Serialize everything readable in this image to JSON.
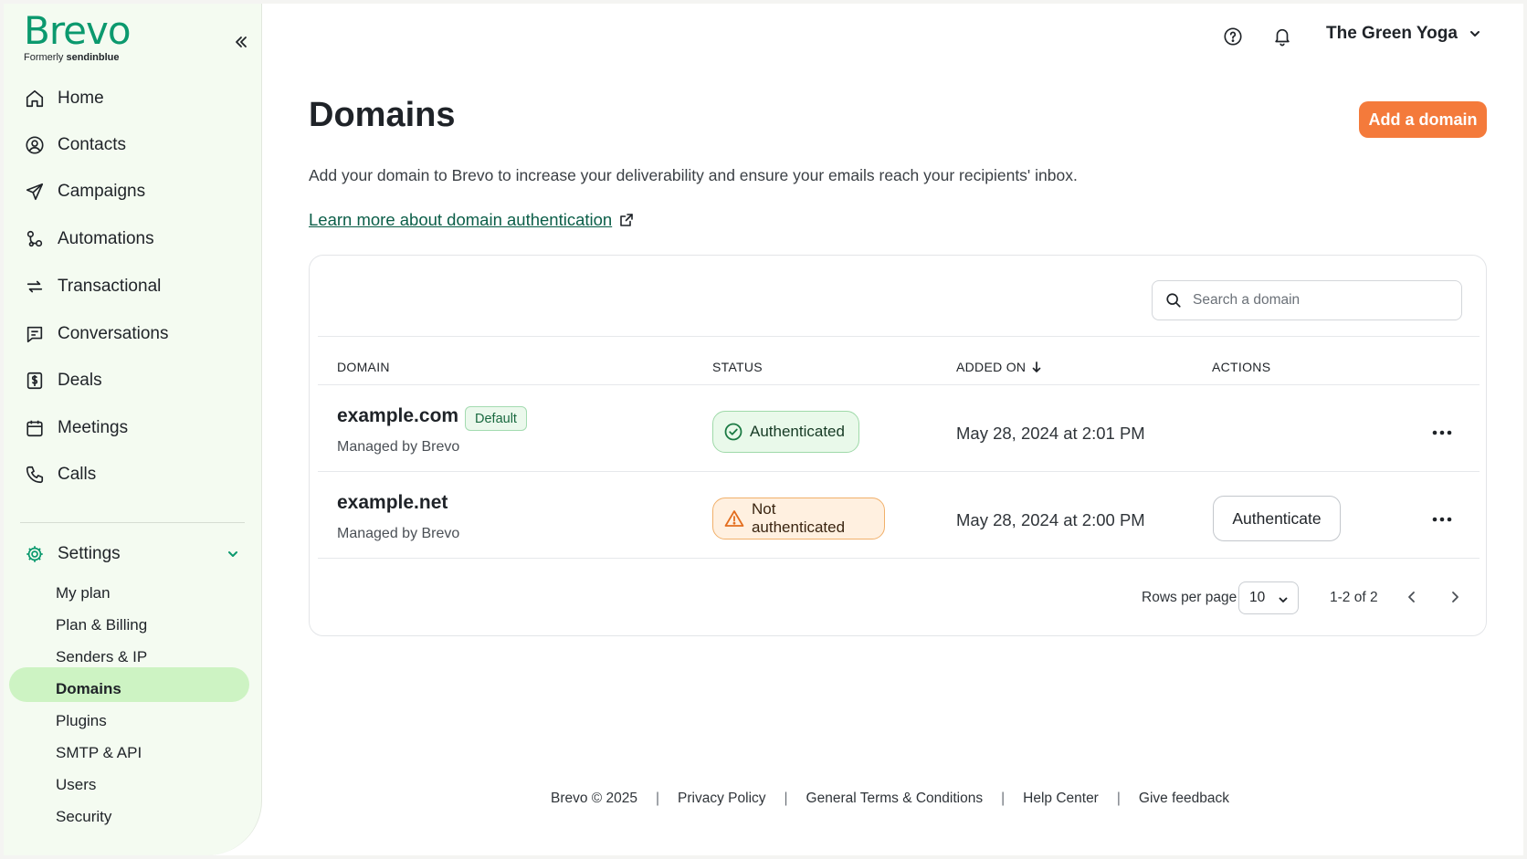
{
  "brand": {
    "logo_text": "Brevo",
    "formerly": "Formerly",
    "formerly_brand": "sendinblue",
    "accent": "#0b996e",
    "cta_color": "#f47a3b"
  },
  "header": {
    "account_name": "The Green Yoga",
    "help_icon": "help-circle-icon",
    "bell_icon": "bell-icon"
  },
  "sidebar": {
    "items": [
      {
        "label": "Home",
        "icon": "home-icon"
      },
      {
        "label": "Contacts",
        "icon": "contacts-icon"
      },
      {
        "label": "Campaigns",
        "icon": "send-icon"
      },
      {
        "label": "Automations",
        "icon": "automation-icon"
      },
      {
        "label": "Transactional",
        "icon": "repeat-icon"
      },
      {
        "label": "Conversations",
        "icon": "chat-icon"
      },
      {
        "label": "Deals",
        "icon": "dollar-icon"
      },
      {
        "label": "Meetings",
        "icon": "calendar-icon"
      },
      {
        "label": "Calls",
        "icon": "phone-icon"
      }
    ],
    "settings": {
      "label": "Settings",
      "icon": "gear-icon",
      "sub_items": [
        "My plan",
        "Plan & Billing",
        "Senders & IP",
        "Domains",
        "Plugins",
        "SMTP & API",
        "Users",
        "Security"
      ],
      "active": "Domains"
    }
  },
  "main": {
    "title": "Domains",
    "add_button": "Add a domain",
    "description": "Add your domain to Brevo to increase your deliverability and ensure your emails reach your recipients' inbox.",
    "learn_link": "Learn more about domain authentication",
    "search_placeholder": "Search a domain",
    "columns": [
      "DOMAIN",
      "STATUS",
      "ADDED ON",
      "ACTIONS"
    ],
    "rows": [
      {
        "domain": "example.com",
        "badge": "Default",
        "managed": "Managed by Brevo",
        "status": "Authenticated",
        "added_on": "May 28, 2024 at 2:01 PM"
      },
      {
        "domain": "example.net",
        "managed": "Managed by Brevo",
        "status": "Not authenticated",
        "added_on": "May 28, 2024 at 2:00 PM",
        "action": "Authenticate"
      }
    ],
    "pagination": {
      "rows_per_page_label": "Rows per page",
      "rows_per_page": "10",
      "range": "1-2 of 2"
    }
  },
  "footer": {
    "copyright": "Brevo © 2025",
    "links": [
      "Privacy Policy",
      "General Terms & Conditions",
      "Help Center",
      "Give feedback"
    ],
    "separator": "|"
  }
}
